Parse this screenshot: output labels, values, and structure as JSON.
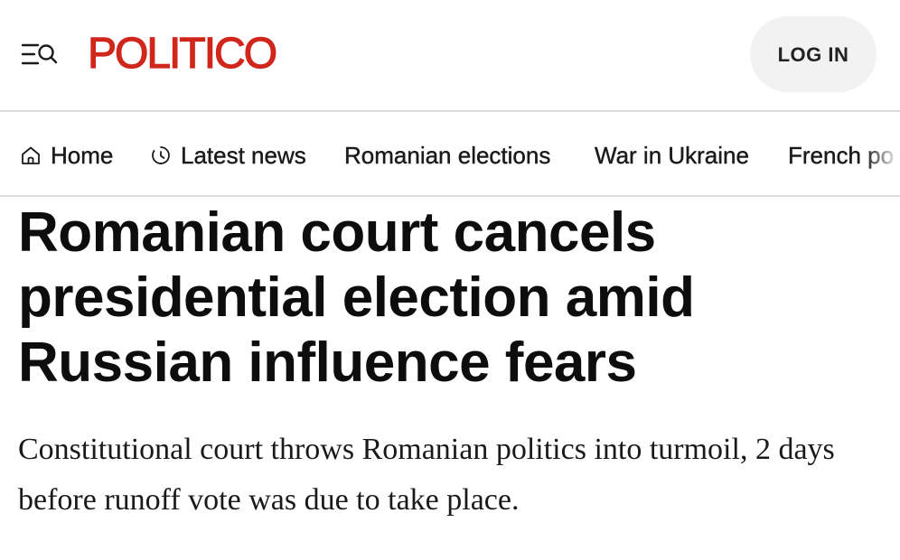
{
  "header": {
    "menu_search_icon": "menu-search-icon",
    "logo_text": "POLITICO",
    "login_label": "LOG IN",
    "brand_color": "#d0261b"
  },
  "nav": {
    "items": [
      {
        "label": "Home",
        "icon": "home-icon"
      },
      {
        "label": "Latest news",
        "icon": "clock-icon"
      },
      {
        "label": "Romanian elections"
      },
      {
        "label": "War in Ukraine"
      },
      {
        "label": "French po"
      }
    ]
  },
  "article": {
    "headline": "Romanian court cancels presidential election amid Russian influence fears",
    "subheadline": "Constitutional court throws Romanian politics into turmoil, 2 days before runoff vote was due to take place."
  }
}
